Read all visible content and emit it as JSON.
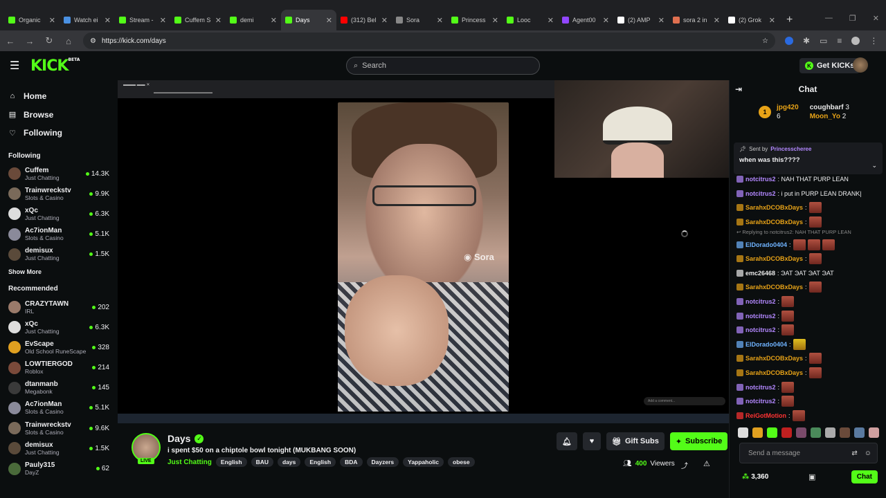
{
  "browser": {
    "tabs": [
      {
        "title": "Organic",
        "color": "#53fc18"
      },
      {
        "title": "Watch ei",
        "color": "#4a90e2"
      },
      {
        "title": "Stream -",
        "color": "#53fc18"
      },
      {
        "title": "Cuffem S",
        "color": "#53fc18"
      },
      {
        "title": "demi",
        "color": "#53fc18"
      },
      {
        "title": "Days",
        "color": "#53fc18"
      },
      {
        "title": "(312) Bel",
        "color": "#ff0000"
      },
      {
        "title": "Sora",
        "color": "#888888"
      },
      {
        "title": "Princess",
        "color": "#53fc18"
      },
      {
        "title": "Looc",
        "color": "#53fc18"
      },
      {
        "title": "Agent00",
        "color": "#9146ff"
      },
      {
        "title": "(2) AMP",
        "color": "#ffffff"
      },
      {
        "title": "sora 2 in",
        "color": "#e07050"
      },
      {
        "title": "(2) Grok",
        "color": "#ffffff"
      }
    ],
    "active_tab": 5,
    "url": "https://kick.com/days"
  },
  "nav": {
    "logo": "KICK",
    "logo_sup": "BETA",
    "search_placeholder": "Search",
    "get_kicks": "Get KICKs"
  },
  "sidebar": {
    "main": [
      {
        "label": "Home",
        "icon": "⌂"
      },
      {
        "label": "Browse",
        "icon": "▤"
      },
      {
        "label": "Following",
        "icon": "♡"
      }
    ],
    "following_title": "Following",
    "following": [
      {
        "name": "Cuffem",
        "cat": "Just Chatting",
        "viewers": "14.3K",
        "color": "#6a4a3a"
      },
      {
        "name": "Trainwreckstv",
        "cat": "Slots & Casino",
        "viewers": "9.9K",
        "color": "#7a6a5a"
      },
      {
        "name": "xQc",
        "cat": "Just Chatting",
        "viewers": "6.3K",
        "color": "#dddddd"
      },
      {
        "name": "Ac7ionMan",
        "cat": "Slots & Casino",
        "viewers": "5.1K",
        "color": "#8a8a9a"
      },
      {
        "name": "demisux",
        "cat": "Just Chatting",
        "viewers": "1.5K",
        "color": "#5a4a3a"
      }
    ],
    "show_more": "Show More",
    "recommended_title": "Recommended",
    "recommended": [
      {
        "name": "CRAZYTAWN",
        "cat": "IRL",
        "viewers": "202",
        "color": "#9a7a6a"
      },
      {
        "name": "xQc",
        "cat": "Just Chatting",
        "viewers": "6.3K",
        "color": "#dddddd"
      },
      {
        "name": "EvScape",
        "cat": "Old School RuneScape",
        "viewers": "328",
        "color": "#e0a020"
      },
      {
        "name": "LOWTIERGOD",
        "cat": "Roblox",
        "viewers": "214",
        "color": "#7a4a3a"
      },
      {
        "name": "dtanmanb",
        "cat": "Megabonk",
        "viewers": "145",
        "color": "#3a3a3a"
      },
      {
        "name": "Ac7ionMan",
        "cat": "Slots & Casino",
        "viewers": "5.1K",
        "color": "#8a8a9a"
      },
      {
        "name": "Trainwreckstv",
        "cat": "Slots & Casino",
        "viewers": "9.6K",
        "color": "#7a6a5a"
      },
      {
        "name": "demisux",
        "cat": "Just Chatting",
        "viewers": "1.5K",
        "color": "#5a4a3a"
      },
      {
        "name": "Pauly315",
        "cat": "DayZ",
        "viewers": "62",
        "color": "#4a6a3a"
      }
    ]
  },
  "player": {
    "watermark": "Sora",
    "comment_placeholder": "Add a comment..."
  },
  "stream": {
    "live": "LIVE",
    "name": "Days",
    "title": "i spent $50 on a chiptole bowl tonight (MUKBANG SOON)",
    "category": "Just Chatting",
    "tags": [
      "English",
      "BAU",
      "days",
      "English",
      "BDA",
      "Dayzers",
      "Yappaholic",
      "obese"
    ],
    "gift_subs": "Gift Subs",
    "subscribe": "Subscribe",
    "viewers_count": "400",
    "viewers_label": "Viewers"
  },
  "chat": {
    "title": "Chat",
    "leaderboard": [
      {
        "rank": "1",
        "name": "jpg420",
        "count": "6",
        "color": "#e8a317"
      },
      {
        "name": "coughbarf",
        "count": "3",
        "color": "#eaeaea"
      },
      {
        "name": "Moon_Yo",
        "count": "2",
        "color": "#e8a317"
      }
    ],
    "pinned_sent_by": "Sent by",
    "pinned_user": "Princesscheree",
    "pinned_msg": "when was this????",
    "messages": [
      {
        "user": "notcitrus2",
        "color": "#b388ff",
        "text": ": NAH THAT PURP LEAN",
        "emotes": 0
      },
      {
        "user": "notcitrus2",
        "color": "#b388ff",
        "text": ": i put in PURP LEAN DRANK|",
        "emotes": 0
      },
      {
        "user": "SarahxDCOBxDays",
        "color": "#e8a317",
        "text": ":",
        "emotes": 1
      },
      {
        "user": "SarahxDCOBxDays",
        "color": "#e8a317",
        "text": ":",
        "emotes": 1
      },
      {
        "reply": "Replying to notcitrus2: NAH THAT PURP LEAN"
      },
      {
        "user": "ElDorado0404",
        "color": "#6fb3ff",
        "text": ":",
        "emotes": 3
      },
      {
        "user": "SarahxDCOBxDays",
        "color": "#e8a317",
        "text": ":",
        "emotes": 1
      },
      {
        "user": "emc26468",
        "color": "#eaeaea",
        "text": ": ЭАТ ЭАТ ЭАТ ЭАТ",
        "emotes": 0
      },
      {
        "user": "SarahxDCOBxDays",
        "color": "#e8a317",
        "text": ":",
        "emotes": 1
      },
      {
        "user": "notcitrus2",
        "color": "#b388ff",
        "text": ":",
        "emotes": 1
      },
      {
        "user": "notcitrus2",
        "color": "#b388ff",
        "text": ":",
        "emotes": 1
      },
      {
        "user": "notcitrus2",
        "color": "#b388ff",
        "text": ":",
        "emotes": 1
      },
      {
        "user": "ElDorado0404",
        "color": "#6fb3ff",
        "text": ":",
        "emotes": 1,
        "yellow": true
      },
      {
        "user": "SarahxDCOBxDays",
        "color": "#e8a317",
        "text": ":",
        "emotes": 1
      },
      {
        "user": "SarahxDCOBxDays",
        "color": "#e8a317",
        "text": ":",
        "emotes": 1
      },
      {
        "user": "notcitrus2",
        "color": "#b388ff",
        "text": ":",
        "emotes": 1
      },
      {
        "user": "notcitrus2",
        "color": "#b388ff",
        "text": ":",
        "emotes": 1
      },
      {
        "user": "ReiGotMotion",
        "color": "#ff3333",
        "text": ":",
        "emotes": 1
      }
    ],
    "input_placeholder": "Send a message",
    "points": "3,360",
    "chat_button": "Chat"
  },
  "colors": {
    "kick_green": "#53fc18"
  }
}
